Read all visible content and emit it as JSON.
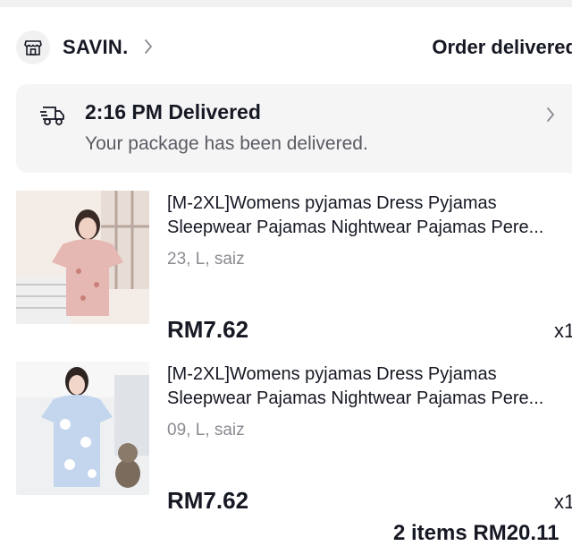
{
  "shop": {
    "icon": "shop-icon",
    "name": "SAVIN.",
    "chevron_icon": "chevron-right-icon",
    "order_status": "Order delivered"
  },
  "delivery": {
    "icon": "truck-icon",
    "title": "2:16 PM Delivered",
    "subtitle": "Your package has been delivered.",
    "chevron_icon": "chevron-right-icon"
  },
  "items": [
    {
      "title_line1": "[M-2XL]Womens pyjamas Dress Pyjamas",
      "title_line2": "Sleepwear Pajamas Nightwear Pajamas Pere...",
      "variant": "23, L, saiz",
      "price": "RM7.62",
      "qty": "x1",
      "image_colors": [
        "#e8c7c4",
        "#d39c97"
      ]
    },
    {
      "title_line1": "[M-2XL]Womens pyjamas Dress Pyjamas",
      "title_line2": "Sleepwear Pajamas Nightwear Pajamas Pere...",
      "variant": "09, L, saiz",
      "price": "RM7.62",
      "qty": "x1",
      "image_colors": [
        "#e9ecef",
        "#a9c3e3"
      ]
    }
  ],
  "summary_partial": "2 items  RM20.11"
}
